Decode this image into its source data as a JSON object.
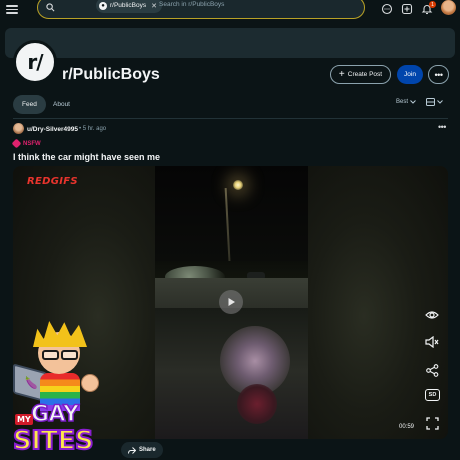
{
  "search": {
    "community_chip": "r/PublicBoys",
    "placeholder": "Search in r/PublicBoys"
  },
  "header": {
    "notification_count": "1"
  },
  "community": {
    "icon_text": "r/",
    "title": "r/PublicBoys",
    "create_post_label": "Create Post",
    "join_label": "Join"
  },
  "tabs": [
    {
      "label": "Feed",
      "active": true
    },
    {
      "label": "About",
      "active": false
    }
  ],
  "feed": {
    "sort_label": "Best"
  },
  "post": {
    "username": "u/Dry-Silver4995",
    "time": "• 5 hr. ago",
    "nsfw_label": "NSFW",
    "title": "I think the car might have seen me",
    "media": {
      "watermark": "REDGIFS",
      "quality": "SD",
      "duration": "00:59"
    },
    "share_label": "Share"
  },
  "overlay_logo": {
    "line1": "MY",
    "line2": "GAY",
    "line3": "SITES"
  },
  "colors": {
    "background": "#0b1416",
    "accent_join": "#0045ac",
    "nsfw": "#e0226e",
    "search_border": "#b8a126"
  }
}
